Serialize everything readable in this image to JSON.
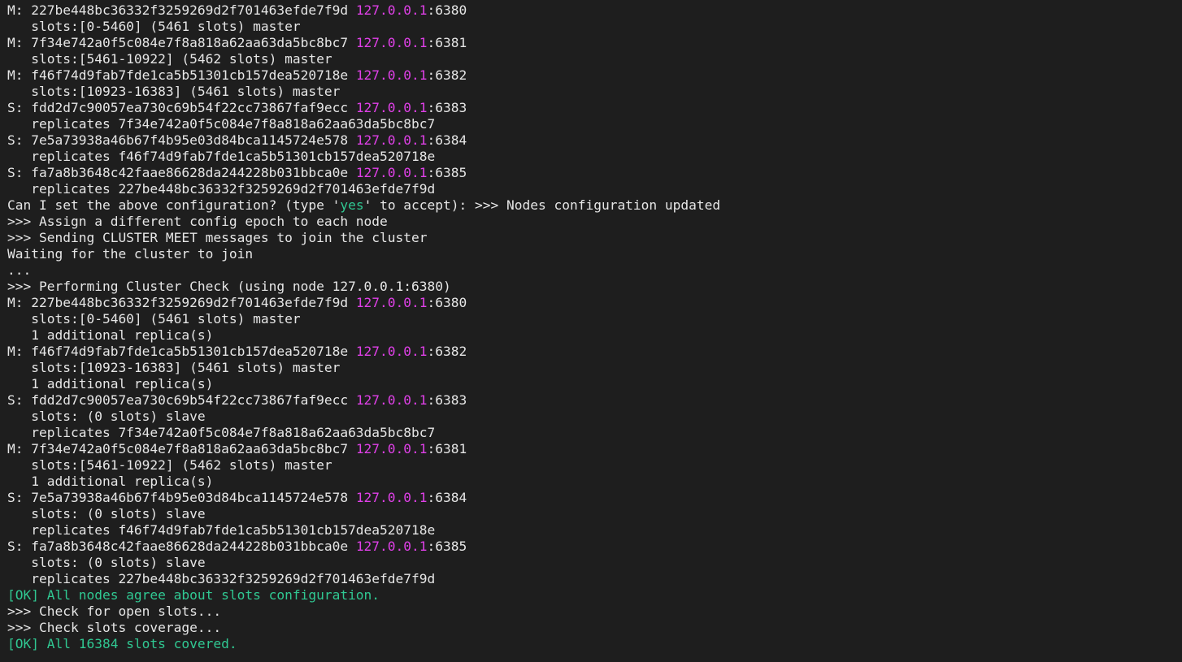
{
  "colors": {
    "background": "#1e1e1e",
    "text": "#e6e6e6",
    "ip_highlight": "#e040e8",
    "ok_green": "#30c892"
  },
  "terminal": {
    "lines": [
      {
        "parts": [
          {
            "t": "M: 227be448bc36332f3259269d2f701463efde7f9d "
          },
          {
            "t": "127.0.0.1",
            "c": "ip"
          },
          {
            "t": ":6380"
          }
        ]
      },
      {
        "parts": [
          {
            "t": "   slots:[0-5460] (5461 slots) master"
          }
        ]
      },
      {
        "parts": [
          {
            "t": "M: 7f34e742a0f5c084e7f8a818a62aa63da5bc8bc7 "
          },
          {
            "t": "127.0.0.1",
            "c": "ip"
          },
          {
            "t": ":6381"
          }
        ]
      },
      {
        "parts": [
          {
            "t": "   slots:[5461-10922] (5462 slots) master"
          }
        ]
      },
      {
        "parts": [
          {
            "t": "M: f46f74d9fab7fde1ca5b51301cb157dea520718e "
          },
          {
            "t": "127.0.0.1",
            "c": "ip"
          },
          {
            "t": ":6382"
          }
        ]
      },
      {
        "parts": [
          {
            "t": "   slots:[10923-16383] (5461 slots) master"
          }
        ]
      },
      {
        "parts": [
          {
            "t": "S: fdd2d7c90057ea730c69b54f22cc73867faf9ecc "
          },
          {
            "t": "127.0.0.1",
            "c": "ip"
          },
          {
            "t": ":6383"
          }
        ]
      },
      {
        "parts": [
          {
            "t": "   replicates 7f34e742a0f5c084e7f8a818a62aa63da5bc8bc7"
          }
        ]
      },
      {
        "parts": [
          {
            "t": "S: 7e5a73938a46b67f4b95e03d84bca1145724e578 "
          },
          {
            "t": "127.0.0.1",
            "c": "ip"
          },
          {
            "t": ":6384"
          }
        ]
      },
      {
        "parts": [
          {
            "t": "   replicates f46f74d9fab7fde1ca5b51301cb157dea520718e"
          }
        ]
      },
      {
        "parts": [
          {
            "t": "S: fa7a8b3648c42faae86628da244228b031bbca0e "
          },
          {
            "t": "127.0.0.1",
            "c": "ip"
          },
          {
            "t": ":6385"
          }
        ]
      },
      {
        "parts": [
          {
            "t": "   replicates 227be448bc36332f3259269d2f701463efde7f9d"
          }
        ]
      },
      {
        "parts": [
          {
            "t": "Can I set the above configuration? (type '"
          },
          {
            "t": "yes",
            "c": "yes"
          },
          {
            "t": "' to accept): >>> Nodes configuration updated"
          }
        ]
      },
      {
        "parts": [
          {
            "t": ">>> Assign a different config epoch to each node"
          }
        ]
      },
      {
        "parts": [
          {
            "t": ">>> Sending CLUSTER MEET messages to join the cluster"
          }
        ]
      },
      {
        "parts": [
          {
            "t": "Waiting for the cluster to join"
          }
        ]
      },
      {
        "parts": [
          {
            "t": "..."
          }
        ]
      },
      {
        "parts": [
          {
            "t": ">>> Performing Cluster Check (using node 127.0.0.1:6380)"
          }
        ]
      },
      {
        "parts": [
          {
            "t": "M: 227be448bc36332f3259269d2f701463efde7f9d "
          },
          {
            "t": "127.0.0.1",
            "c": "ip"
          },
          {
            "t": ":6380"
          }
        ]
      },
      {
        "parts": [
          {
            "t": "   slots:[0-5460] (5461 slots) master"
          }
        ]
      },
      {
        "parts": [
          {
            "t": "   1 additional replica(s)"
          }
        ]
      },
      {
        "parts": [
          {
            "t": "M: f46f74d9fab7fde1ca5b51301cb157dea520718e "
          },
          {
            "t": "127.0.0.1",
            "c": "ip"
          },
          {
            "t": ":6382"
          }
        ]
      },
      {
        "parts": [
          {
            "t": "   slots:[10923-16383] (5461 slots) master"
          }
        ]
      },
      {
        "parts": [
          {
            "t": "   1 additional replica(s)"
          }
        ]
      },
      {
        "parts": [
          {
            "t": "S: fdd2d7c90057ea730c69b54f22cc73867faf9ecc "
          },
          {
            "t": "127.0.0.1",
            "c": "ip"
          },
          {
            "t": ":6383"
          }
        ]
      },
      {
        "parts": [
          {
            "t": "   slots: (0 slots) slave"
          }
        ]
      },
      {
        "parts": [
          {
            "t": "   replicates 7f34e742a0f5c084e7f8a818a62aa63da5bc8bc7"
          }
        ]
      },
      {
        "parts": [
          {
            "t": "M: 7f34e742a0f5c084e7f8a818a62aa63da5bc8bc7 "
          },
          {
            "t": "127.0.0.1",
            "c": "ip"
          },
          {
            "t": ":6381"
          }
        ]
      },
      {
        "parts": [
          {
            "t": "   slots:[5461-10922] (5462 slots) master"
          }
        ]
      },
      {
        "parts": [
          {
            "t": "   1 additional replica(s)"
          }
        ]
      },
      {
        "parts": [
          {
            "t": "S: 7e5a73938a46b67f4b95e03d84bca1145724e578 "
          },
          {
            "t": "127.0.0.1",
            "c": "ip"
          },
          {
            "t": ":6384"
          }
        ]
      },
      {
        "parts": [
          {
            "t": "   slots: (0 slots) slave"
          }
        ]
      },
      {
        "parts": [
          {
            "t": "   replicates f46f74d9fab7fde1ca5b51301cb157dea520718e"
          }
        ]
      },
      {
        "parts": [
          {
            "t": "S: fa7a8b3648c42faae86628da244228b031bbca0e "
          },
          {
            "t": "127.0.0.1",
            "c": "ip"
          },
          {
            "t": ":6385"
          }
        ]
      },
      {
        "parts": [
          {
            "t": "   slots: (0 slots) slave"
          }
        ]
      },
      {
        "parts": [
          {
            "t": "   replicates 227be448bc36332f3259269d2f701463efde7f9d"
          }
        ]
      },
      {
        "parts": [
          {
            "t": "[OK] All nodes agree about slots configuration.",
            "c": "ok"
          }
        ]
      },
      {
        "parts": [
          {
            "t": ">>> Check for open slots..."
          }
        ]
      },
      {
        "parts": [
          {
            "t": ">>> Check slots coverage..."
          }
        ]
      },
      {
        "parts": [
          {
            "t": "[OK] All 16384 slots covered.",
            "c": "ok"
          }
        ]
      }
    ]
  }
}
